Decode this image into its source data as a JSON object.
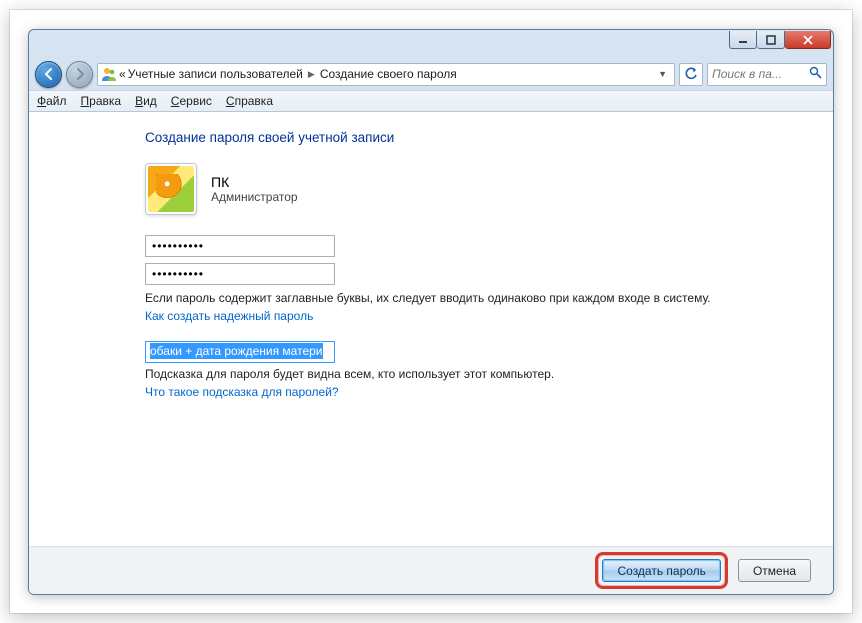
{
  "titlebar": {
    "minimize": "–",
    "maximize": "□",
    "close": "×"
  },
  "nav": {
    "crumb_prefix": "«",
    "crumb1": "Учетные записи пользователей",
    "crumb2": "Создание своего пароля",
    "search_placeholder": "Поиск в па..."
  },
  "menu": {
    "file": "Файл",
    "edit": "Правка",
    "view": "Вид",
    "tools": "Сервис",
    "help": "Справка"
  },
  "page": {
    "heading": "Создание пароля своей учетной записи",
    "user_name": "ПК",
    "user_role": "Администратор",
    "password1": "••••••••••",
    "password2": "••••••••••",
    "caps_note": "Если пароль содержит заглавные буквы, их следует вводить одинаково при каждом входе в систему.",
    "strong_link": "Как создать надежный пароль",
    "hint_value": "обаки + дата рождения матери",
    "hint_note": "Подсказка для пароля будет видна всем, кто использует этот компьютер.",
    "hint_link": "Что такое подсказка для паролей?"
  },
  "footer": {
    "ok": "Создать пароль",
    "cancel": "Отмена"
  }
}
